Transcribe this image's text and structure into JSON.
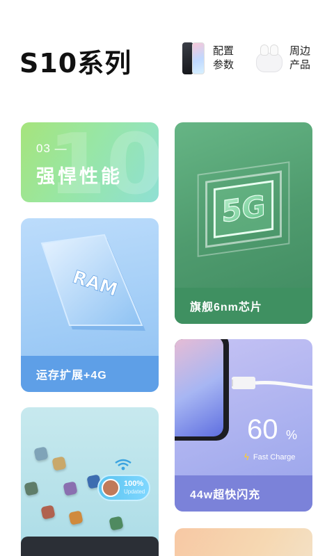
{
  "header": {
    "brand_title": "S10系列",
    "nav": [
      {
        "label": "配置\n参数"
      },
      {
        "label": "周边\n产品"
      }
    ]
  },
  "cards": {
    "performance": {
      "number": "03 —",
      "title": "强悍性能",
      "ghost": "10"
    },
    "chip": {
      "caption": "旗舰6nm芯片",
      "graphic_text": "5G"
    },
    "ram": {
      "caption": "运存扩展+4G",
      "graphic_text": "RAM"
    },
    "charge": {
      "caption": "44w超快闪充",
      "percent": "60",
      "percent_sign": "%",
      "fast_label": "Fast Charge"
    },
    "game": {
      "badge_value": "100%",
      "badge_sub": "Updated"
    }
  },
  "colors": {
    "perf_gradient_start": "#a6e47c",
    "chip_green": "#3f9061",
    "ram_blue": "#5e9fe7",
    "charge_purple": "#7b82d9"
  },
  "icons": [
    "phone-product-icon",
    "earbuds-product-icon",
    "wifi-icon",
    "bolt-icon"
  ]
}
